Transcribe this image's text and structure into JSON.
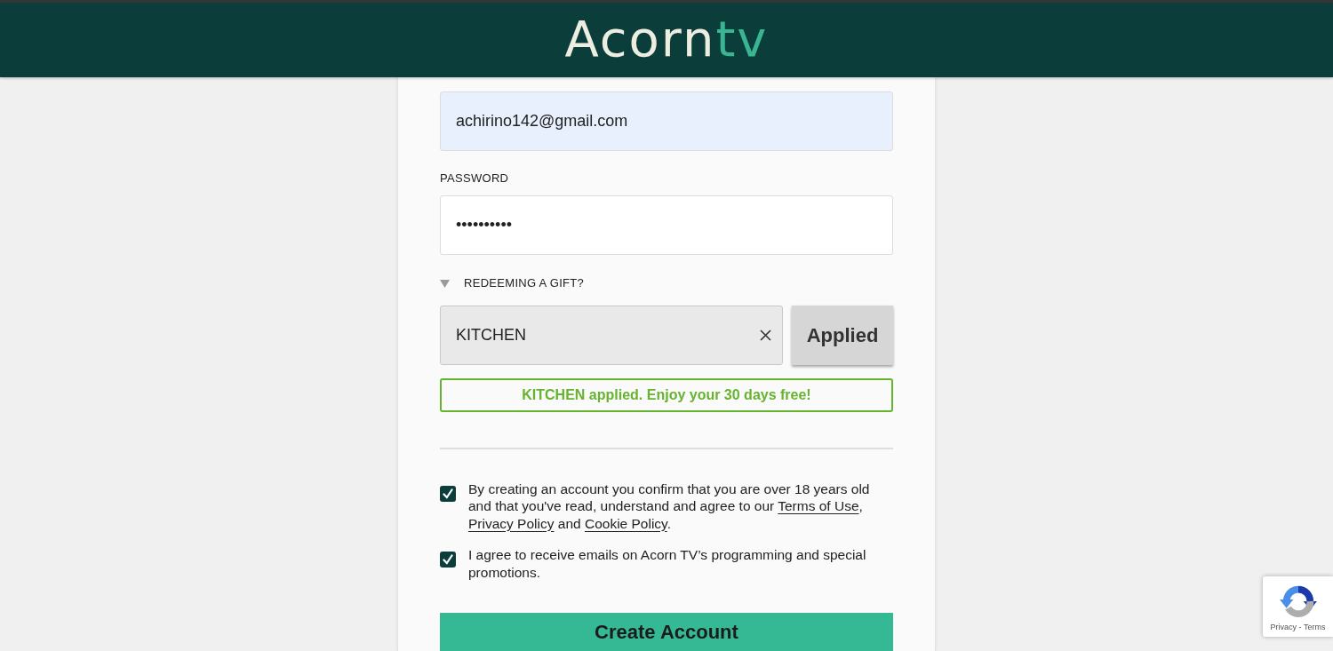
{
  "header": {
    "logo": {
      "text": "Acorn",
      "accent": "tv"
    }
  },
  "form": {
    "email": {
      "value": "achirino142@gmail.com",
      "autofilled": true
    },
    "password": {
      "label": "PASSWORD",
      "value": "••••••••••"
    },
    "gift": {
      "label": "REDEEMING A GIFT?",
      "expanded": true,
      "code": "KITCHEN",
      "button": {
        "label": "Applied",
        "disabled": true
      },
      "message": "KITCHEN applied. Enjoy your 30 days free!"
    },
    "agreements": [
      {
        "checked": true,
        "segments": [
          {
            "kind": "text",
            "text": "By creating an account you confirm that you are over 18 years old and that you've read, understand and agree to our "
          },
          {
            "kind": "link",
            "text": "Terms of Use"
          },
          {
            "kind": "text",
            "text": ", "
          },
          {
            "kind": "link",
            "text": "Privacy Policy"
          },
          {
            "kind": "text",
            "text": " and "
          },
          {
            "kind": "link",
            "text": "Cookie Policy"
          },
          {
            "kind": "text",
            "text": "."
          }
        ]
      },
      {
        "checked": true,
        "segments": [
          {
            "kind": "text",
            "text": "I agree to receive emails on Acorn TV’s programming and special promotions."
          }
        ]
      }
    ],
    "submit": {
      "label": "Create Account"
    }
  },
  "captcha_badge": {
    "links": "Privacy - Terms"
  }
}
